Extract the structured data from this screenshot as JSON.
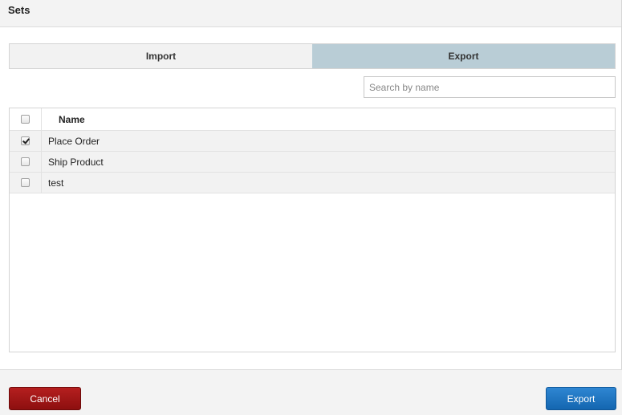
{
  "dialog": {
    "title": "Sets"
  },
  "tabs": [
    {
      "label": "Import",
      "active": false
    },
    {
      "label": "Export",
      "active": true
    }
  ],
  "search": {
    "placeholder": "Search by name",
    "value": ""
  },
  "table": {
    "columns": [
      "Name"
    ],
    "select_all_checked": false,
    "rows": [
      {
        "name": "Place Order",
        "checked": true
      },
      {
        "name": "Ship Product",
        "checked": false
      },
      {
        "name": "test",
        "checked": false
      }
    ]
  },
  "footer": {
    "cancel_label": "Cancel",
    "export_label": "Export"
  },
  "colors": {
    "active_tab": "#b9cdd6",
    "cancel_button": "#a11818",
    "export_button": "#1f74c0"
  }
}
